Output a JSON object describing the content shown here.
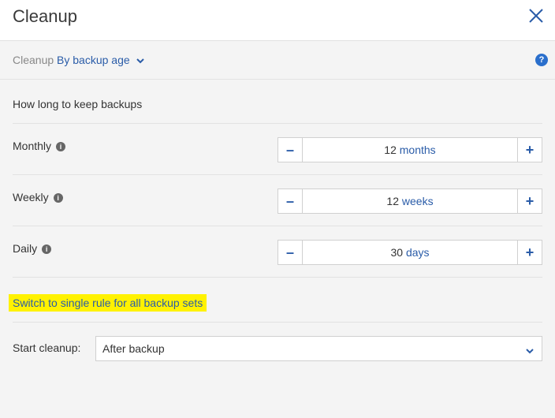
{
  "header": {
    "title": "Cleanup",
    "close_icon": "close-icon"
  },
  "subheader": {
    "label": "Cleanup",
    "mode": "By backup age",
    "help_icon": "help-icon",
    "help_symbol": "?"
  },
  "section": {
    "title": "How long to keep backups"
  },
  "rows": [
    {
      "label": "Monthly",
      "value": "12",
      "unit": "months"
    },
    {
      "label": "Weekly",
      "value": "12",
      "unit": "weeks"
    },
    {
      "label": "Daily",
      "value": "30",
      "unit": "days"
    }
  ],
  "stepper": {
    "minus": "–",
    "plus": "+"
  },
  "info_symbol": "i",
  "switch_link": "Switch to single rule for all backup sets",
  "start_cleanup": {
    "label": "Start cleanup:",
    "value": "After backup"
  },
  "colors": {
    "accent": "#2a5ca8",
    "highlight": "#fff200"
  }
}
